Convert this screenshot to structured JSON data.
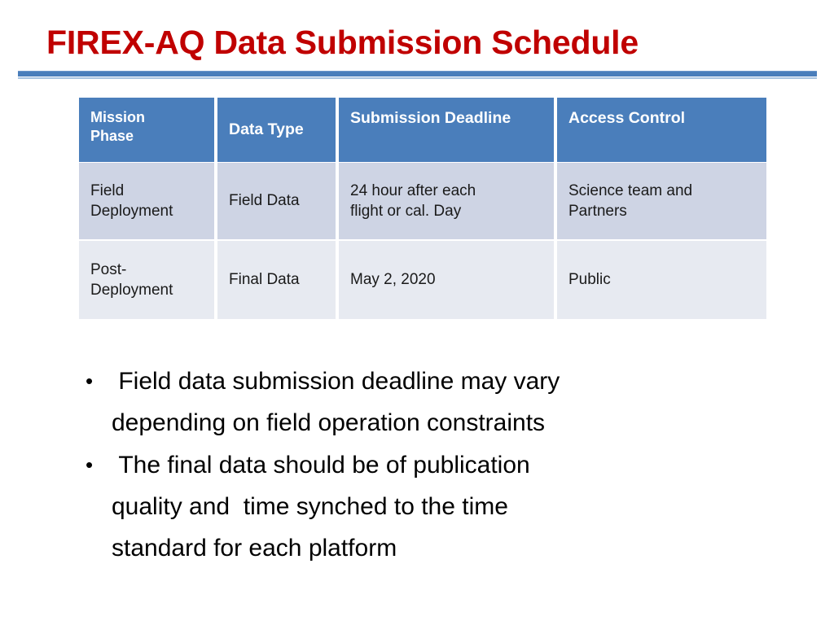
{
  "slide": {
    "title": "FIREX-AQ Data Submission Schedule",
    "title_color": "#c00000",
    "divider_color": "#4a7ebb",
    "divider_color_light": "#a8c3e0",
    "background": "#ffffff"
  },
  "table": {
    "header_bg": "#4a7ebb",
    "header_text_color": "#ffffff",
    "row_alt_bg_1": "#ced4e4",
    "row_alt_bg_2": "#e7eaf1",
    "columns": [
      "Mission Phase",
      "Data Type",
      "Submission Deadline",
      "Access Control"
    ],
    "header_cells": {
      "mission_phase_line1": "Mission",
      "mission_phase_line2": "Phase",
      "data_type": "Data Type",
      "submission_deadline": "Submission Deadline",
      "access_control": "Access Control"
    },
    "rows": [
      {
        "mission_phase_line1": "Field",
        "mission_phase_line2": "Deployment",
        "data_type": "Field Data",
        "deadline_line1": "24 hour after each",
        "deadline_line2": "flight or  cal. Day",
        "access_line1": "Science team and",
        "access_line2": "Partners"
      },
      {
        "mission_phase_line1": "Post-",
        "mission_phase_line2": "Deployment",
        "data_type": "Final Data",
        "deadline_line1": "May 2, 2020",
        "deadline_line2": "",
        "access_line1": "Public",
        "access_line2": ""
      }
    ]
  },
  "bullets": {
    "marker": "•",
    "items": [
      " Field data submission deadline may vary\ndepending on field operation constraints",
      " The final data should be of publication\nquality and  time synched to the time\nstandard for each platform"
    ]
  }
}
